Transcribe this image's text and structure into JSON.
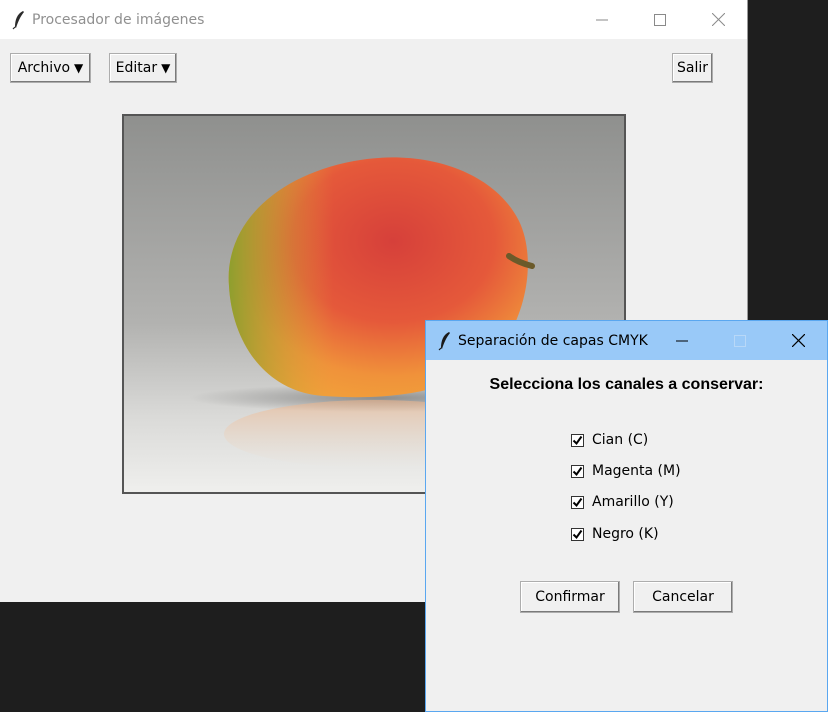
{
  "main_window": {
    "title": "Procesador de imágenes",
    "menus": {
      "file_label": "Archivo",
      "edit_label": "Editar",
      "dropdown_glyph": "▼"
    },
    "exit_label": "Salir",
    "icon": "feather-icon"
  },
  "dialog": {
    "title": "Separación de capas CMYK",
    "heading": "Selecciona los canales a conservar:",
    "channels": [
      {
        "label": "Cian (C)",
        "checked": true
      },
      {
        "label": "Magenta (M)",
        "checked": true
      },
      {
        "label": "Amarillo (Y)",
        "checked": true
      },
      {
        "label": "Negro (K)",
        "checked": true
      }
    ],
    "confirm_label": "Confirmar",
    "cancel_label": "Cancelar",
    "icon": "feather-icon"
  },
  "colors": {
    "desktop": "#1e1e1e",
    "window_bg": "#f0f0f0",
    "dialog_titlebar": "#99c9f8",
    "dialog_border": "#5aa7f0"
  }
}
